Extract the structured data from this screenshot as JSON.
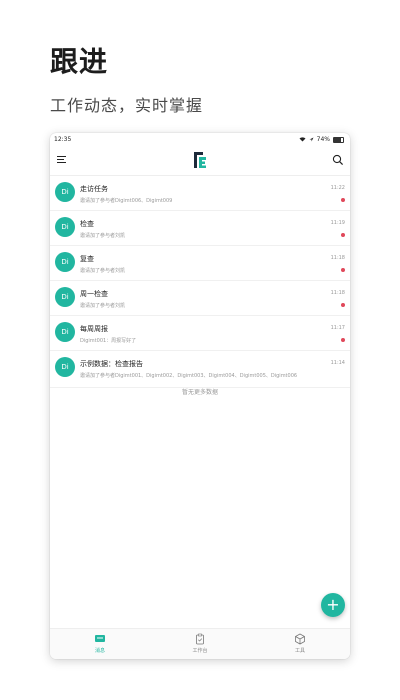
{
  "promo": {
    "title": "跟进",
    "subtitle": "工作动态，实时掌握"
  },
  "status_bar": {
    "time": "12:35",
    "battery": "74%"
  },
  "messages": [
    {
      "avatar": "Di",
      "title": "走访任务",
      "subtitle": "邀请加了参与者Digimt006、Digimt009",
      "time": "11:22",
      "unread": true
    },
    {
      "avatar": "Di",
      "title": "检查",
      "subtitle": "邀请加了参与者刘凯",
      "time": "11:19",
      "unread": true
    },
    {
      "avatar": "Di",
      "title": "复查",
      "subtitle": "邀请加了参与者刘凯",
      "time": "11:18",
      "unread": true
    },
    {
      "avatar": "Di",
      "title": "周一检查",
      "subtitle": "邀请加了参与者刘凯",
      "time": "11:18",
      "unread": true
    },
    {
      "avatar": "Di",
      "title": "每周周报",
      "subtitle": "Digimt001：周报写好了",
      "time": "11:17",
      "unread": true
    },
    {
      "avatar": "Di",
      "title": "示例数据：检查报告",
      "subtitle": "邀请加了参与者Digimt001、Digimt002、Digimt003、Digimt004、Digimt005、Digimt006",
      "time": "11:14",
      "unread": false
    }
  ],
  "list_footer": "暂无更多数据",
  "fab_label": "+",
  "tabs": [
    {
      "label": "消息",
      "icon": "message-icon",
      "active": true
    },
    {
      "label": "工作台",
      "icon": "clipboard-icon",
      "active": false
    },
    {
      "label": "工具",
      "icon": "cube-icon",
      "active": false
    }
  ],
  "colors": {
    "accent": "#21b6a0",
    "unread_dot": "#e0485a",
    "logo_dark": "#1d2a3a"
  }
}
